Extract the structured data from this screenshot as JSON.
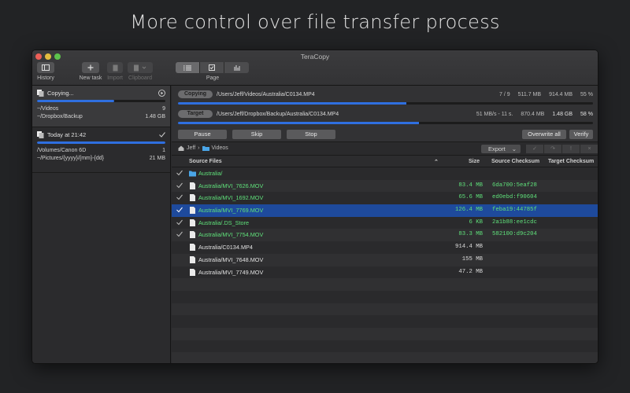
{
  "headline": "More control over file transfer process",
  "window": {
    "title": "TeraCopy"
  },
  "toolbar": {
    "history": "History",
    "new_task": "New task",
    "import": "Import",
    "clipboard": "Clipboard",
    "page": "Page"
  },
  "sidebar": {
    "tasks": [
      {
        "status": "Copying...",
        "progress": 0.6,
        "rows": [
          {
            "left": "~/Videos",
            "right": "9"
          },
          {
            "left": "~/Dropbox/Backup",
            "right": "1.48 GB"
          }
        ]
      },
      {
        "status": "Today at 21:42",
        "progress": 1.0,
        "rows": [
          {
            "left": "/Volumes/Canon 6D",
            "right": "1"
          },
          {
            "left": "~/Pictures/{yyyy}/{mm}-{dd}",
            "right": "21 MB"
          }
        ]
      }
    ]
  },
  "progress": {
    "copying": {
      "label": "Copying",
      "path": "/Users/Jeff/Videos/Australia/C0134.MP4",
      "count": "7 / 9",
      "done": "511.7 MB",
      "total": "914.4 MB",
      "percent": "55 %",
      "fraction": 0.55
    },
    "target": {
      "label": "Target",
      "path": "/Users/Jeff/Dropbox/Backup/Australia/C0134.MP4",
      "speed": "51 MB/s - 11 s.",
      "done": "870.4 MB",
      "total": "1.48 GB",
      "percent": "58 %",
      "fraction": 0.58
    },
    "buttons": {
      "pause": "Pause",
      "skip": "Skip",
      "stop": "Stop",
      "overwrite_all": "Overwrite all",
      "verify": "Verify"
    }
  },
  "pathbar": {
    "root": "Jeff",
    "folder": "Videos",
    "export": "Export"
  },
  "table": {
    "headers": {
      "source_files": "Source Files",
      "size": "Size",
      "source_checksum": "Source Checksum",
      "target_checksum": "Target Checksum"
    },
    "rows": [
      {
        "name": "Australia/",
        "size": "",
        "checksum": "",
        "checked": true,
        "green": true,
        "folder": true,
        "selected": false
      },
      {
        "name": "Australia/MVI_7626.MOV",
        "size": "83.4 MB",
        "checksum": "6da700:5eaf28",
        "checked": true,
        "green": true,
        "folder": false,
        "selected": false
      },
      {
        "name": "Australia/MVI_1692.MOV",
        "size": "65.6 MB",
        "checksum": "ed0ebd:f90604",
        "checked": true,
        "green": true,
        "folder": false,
        "selected": false
      },
      {
        "name": "Australia/MVI_7769.MOV",
        "size": "126.4 MB",
        "checksum": "feba19:44785f",
        "checked": true,
        "green": true,
        "folder": false,
        "selected": true
      },
      {
        "name": "Australia/.DS_Store",
        "size": "6 KB",
        "checksum": "2a1b88:ee1cdc",
        "checked": true,
        "green": true,
        "folder": false,
        "selected": false
      },
      {
        "name": "Australia/MVI_7754.MOV",
        "size": "83.3 MB",
        "checksum": "582100:d9c204",
        "checked": true,
        "green": true,
        "folder": false,
        "selected": false
      },
      {
        "name": "Australia/C0134.MP4",
        "size": "914.4 MB",
        "checksum": "",
        "checked": false,
        "green": false,
        "folder": false,
        "selected": false
      },
      {
        "name": "Australia/MVI_7648.MOV",
        "size": "155 MB",
        "checksum": "",
        "checked": false,
        "green": false,
        "folder": false,
        "selected": false
      },
      {
        "name": "Australia/MVI_7749.MOV",
        "size": "47.2 MB",
        "checksum": "",
        "checked": false,
        "green": false,
        "folder": false,
        "selected": false
      }
    ],
    "empty_rows": 7
  },
  "colors": {
    "accent": "#2f6fe0",
    "verified": "#5fe07a",
    "selection": "#1e4a9c"
  }
}
